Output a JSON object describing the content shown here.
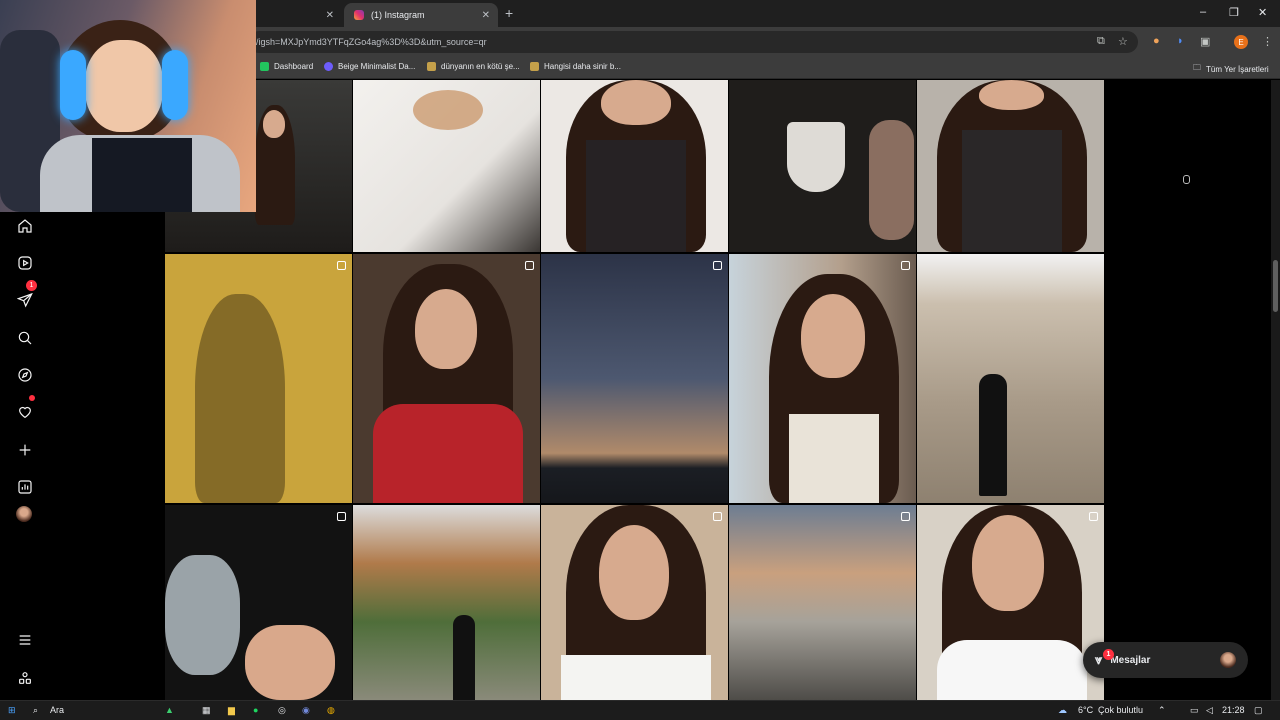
{
  "browser": {
    "tabs": [
      {
        "title": ""
      },
      {
        "title": "(1) Instagram"
      }
    ],
    "new_tab": "+",
    "close": "✕",
    "address": "/igsh=MXJpYmd3YTFqZGo4ag%3D%3D&utm_source=qr",
    "profile_initial": "E",
    "bookmarks": [
      {
        "label": "Dashboard",
        "color": "#22c55e"
      },
      {
        "label": "Beige Minimalist Da...",
        "color": "#6d5dfc"
      },
      {
        "label": "dünyanın en kötü şe...",
        "color": "#c4a04a"
      },
      {
        "label": "Hangisi daha sinir b...",
        "color": "#c4a04a"
      }
    ],
    "all_bookmarks": "Tüm Yer İşaretleri"
  },
  "instagram": {
    "sidebar": [
      {
        "name": "home"
      },
      {
        "name": "reels"
      },
      {
        "name": "direct"
      },
      {
        "name": "search"
      },
      {
        "name": "explore"
      },
      {
        "name": "notifications"
      },
      {
        "name": "create"
      },
      {
        "name": "dashboard"
      },
      {
        "name": "profile"
      },
      {
        "name": "more"
      },
      {
        "name": "threads"
      }
    ],
    "direct_badge": "1",
    "messages": {
      "label": "Mesajlar",
      "badge": "1"
    }
  },
  "taskbar": {
    "search_label": "Ara",
    "weather_temp": "6°C",
    "weather_desc": "Çok bulutlu",
    "time": "21:28"
  }
}
